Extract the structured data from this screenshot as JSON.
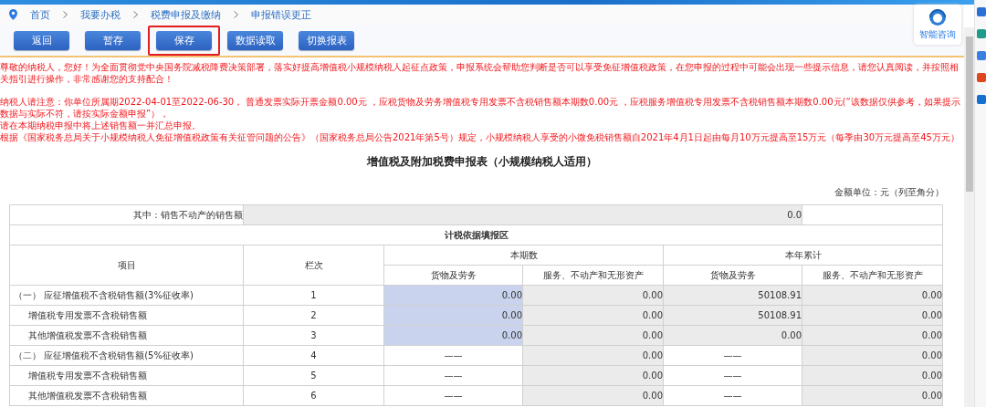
{
  "breadcrumb": [
    "首页",
    "我要办税",
    "税费申报及缴纳",
    "申报错误更正"
  ],
  "buttons": [
    {
      "label": "返回",
      "highlighted": false
    },
    {
      "label": "暂存",
      "highlighted": false
    },
    {
      "label": "保存",
      "highlighted": true
    },
    {
      "label": "数据读取",
      "highlighted": false
    },
    {
      "label": "切换报表",
      "highlighted": false
    }
  ],
  "consult": {
    "label": "智能咨询"
  },
  "notice_groups": [
    [
      "尊敬的纳税人，您好！为全面贯彻党中央国务院减税降费决策部署，落实好提高增值税小规模纳税人起征点政策，申报系统会帮助您判断是否可以享受免征增值税政策，在您申报的过程中可能会出现一些提示信息，请您认真阅读，并按照相关指引进行操作，非常感谢您的支持配合！"
    ],
    [
      "纳税人请注意：你单位所属期2022-04-01至2022-06-30， 普通发票实际开票金额0.00元 ，应税货物及劳务增值税专用发票不含税销售额本期数0.00元 ，应税服务增值税专用发票不含税销售额本期数0.00元(“该数据仅供参考，如果提示数据与实际不符，请按实际金额申报”），",
      "请在本期纳税申报中将上述销售额一并汇总申报。",
      "根据《国家税务总局关于小规模纳税人免征增值税政策有关征管问题的公告》（国家税务总局公告2021年第5号）规定，小规模纳税人享受的小微免税销售额自2021年4月1日起由每月10万元提高至15万元（每季由30万元提高至45万元）"
    ]
  ],
  "form": {
    "title": "增值税及附加税费申报表（小规模纳税人适用）",
    "unit": "金额单位：元（列至角分）",
    "top_row": {
      "label": "其中：销售不动产的销售额",
      "value": "0.0"
    },
    "section": "计税依据填报区",
    "header": {
      "item": "项目",
      "line": "栏次",
      "groups": [
        {
          "label": "本期数",
          "columns": [
            "货物及劳务",
            "服务、不动产和无形资产"
          ]
        },
        {
          "label": "本年累计",
          "columns": [
            "货物及劳务",
            "服务、不动产和无形资产"
          ]
        }
      ]
    },
    "rows": [
      {
        "label": "（一） 应征增值税不含税销售额(3%征收率)",
        "line": "1",
        "cells": [
          {
            "kind": "input",
            "value": "0.00"
          },
          {
            "kind": "calc",
            "value": "0.00"
          },
          {
            "kind": "calc",
            "value": "50108.91"
          },
          {
            "kind": "calc",
            "value": "0.00"
          }
        ],
        "children": [
          {
            "label": "增值税专用发票不含税销售额",
            "line": "2",
            "cells": [
              {
                "kind": "input",
                "value": "0.00"
              },
              {
                "kind": "calc",
                "value": "0.00"
              },
              {
                "kind": "calc",
                "value": "50108.91"
              },
              {
                "kind": "calc",
                "value": "0.00"
              }
            ]
          },
          {
            "label": "其他增值税发票不含税销售额",
            "line": "3",
            "cells": [
              {
                "kind": "input",
                "value": "0.00"
              },
              {
                "kind": "calc",
                "value": "0.00"
              },
              {
                "kind": "calc",
                "value": "0.00"
              },
              {
                "kind": "calc",
                "value": "0.00"
              }
            ]
          }
        ]
      },
      {
        "label": "（二） 应征增值税不含税销售额(5%征收率)",
        "line": "4",
        "cells": [
          {
            "kind": "dash",
            "value": "——"
          },
          {
            "kind": "calc",
            "value": "0.00"
          },
          {
            "kind": "dash",
            "value": "——"
          },
          {
            "kind": "calc",
            "value": "0.00"
          }
        ],
        "children": [
          {
            "label": "增值税专用发票不含税销售额",
            "line": "5",
            "cells": [
              {
                "kind": "dash",
                "value": "——"
              },
              {
                "kind": "calc",
                "value": "0.00"
              },
              {
                "kind": "dash",
                "value": "——"
              },
              {
                "kind": "calc",
                "value": "0.00"
              }
            ]
          },
          {
            "label": "其他增值税发票不含税销售额",
            "line": "6",
            "cells": [
              {
                "kind": "dash",
                "value": "——"
              },
              {
                "kind": "calc",
                "value": "0.00"
              },
              {
                "kind": "dash",
                "value": "——"
              },
              {
                "kind": "calc",
                "value": "0.00"
              }
            ]
          }
        ]
      }
    ]
  }
}
